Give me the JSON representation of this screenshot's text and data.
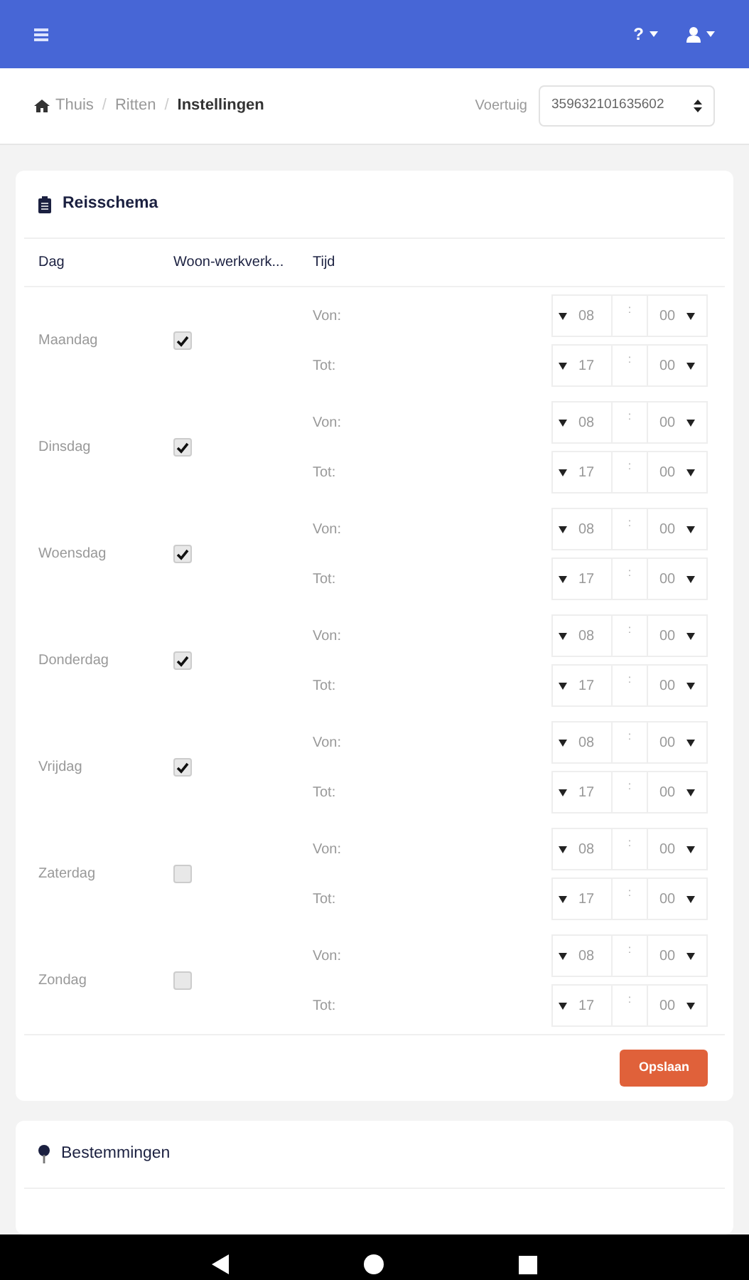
{
  "help": "?",
  "breadcrumb": [
    {
      "label": "Thuis",
      "current": false
    },
    {
      "separator": "/",
      "label": "Ritten",
      "current": false
    },
    {
      "separator": "/",
      "label": "Instellingen",
      "current": true
    }
  ],
  "vehicle": {
    "label": "Voertuig",
    "value": "359632101635602"
  },
  "schedule": {
    "title": "Reisschema",
    "columns": [
      "Dag",
      "Woon-werkverk...",
      "Tijd"
    ],
    "days": [
      {
        "name": "Maandag",
        "checked": true,
        "from": {
          "label": "Von:",
          "hour": "08",
          "separator": ":",
          "minute": "00"
        },
        "to": {
          "label": "Tot:",
          "hour": "17",
          "separator": ":",
          "minute": "00"
        }
      },
      {
        "name": "Dinsdag",
        "checked": true,
        "from": {
          "label": "Von:",
          "hour": "08",
          "separator": ":",
          "minute": "00"
        },
        "to": {
          "label": "Tot:",
          "hour": "17",
          "separator": ":",
          "minute": "00"
        }
      },
      {
        "name": "Woensdag",
        "checked": true,
        "from": {
          "label": "Von:",
          "hour": "08",
          "separator": ":",
          "minute": "00"
        },
        "to": {
          "label": "Tot:",
          "hour": "17",
          "separator": ":",
          "minute": "00"
        }
      },
      {
        "name": "Donderdag",
        "checked": true,
        "from": {
          "label": "Von:",
          "hour": "08",
          "separator": ":",
          "minute": "00"
        },
        "to": {
          "label": "Tot:",
          "hour": "17",
          "separator": ":",
          "minute": "00"
        }
      },
      {
        "name": "Vrijdag",
        "checked": true,
        "from": {
          "label": "Von:",
          "hour": "08",
          "separator": ":",
          "minute": "00"
        },
        "to": {
          "label": "Tot:",
          "hour": "17",
          "separator": ":",
          "minute": "00"
        }
      },
      {
        "name": "Zaterdag",
        "checked": false,
        "from": {
          "label": "Von:",
          "hour": "08",
          "separator": ":",
          "minute": "00"
        },
        "to": {
          "label": "Tot:",
          "hour": "17",
          "separator": ":",
          "minute": "00"
        }
      },
      {
        "name": "Zondag",
        "checked": false,
        "from": {
          "label": "Von:",
          "hour": "08",
          "separator": ":",
          "minute": "00"
        },
        "to": {
          "label": "Tot:",
          "hour": "17",
          "separator": ":",
          "minute": "00"
        }
      }
    ],
    "save": "Opslaan"
  },
  "destinations": {
    "title": "Bestemmingen"
  }
}
